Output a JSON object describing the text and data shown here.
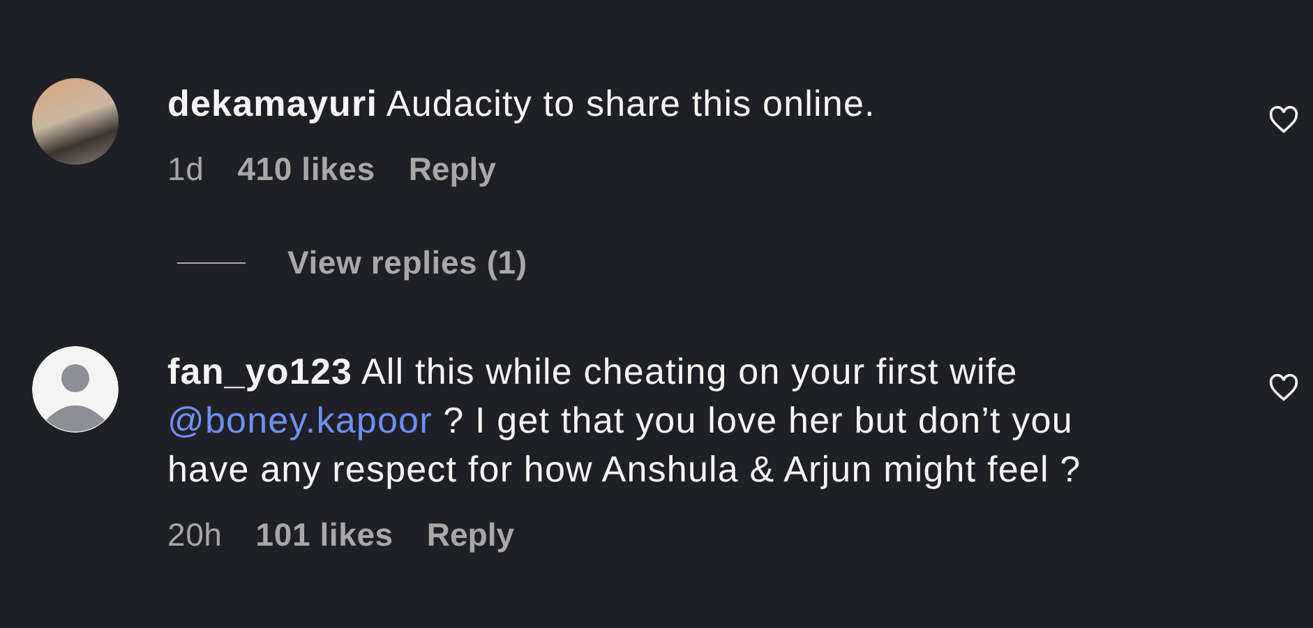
{
  "items": [
    {
      "kind": "comment",
      "username": "dekamayuri",
      "avatar": {
        "kind": "photo"
      },
      "body": [
        {
          "kind": "text",
          "text": "Audacity to share this online."
        }
      ],
      "time": "1d",
      "likes": "410 likes",
      "reply": "Reply",
      "liked": false
    },
    {
      "kind": "replies",
      "label": "View replies (1)"
    },
    {
      "kind": "comment",
      "username": "fan_yo123",
      "avatar": {
        "kind": "default"
      },
      "body": [
        {
          "kind": "text",
          "text": "All this while cheating on your first wife "
        },
        {
          "kind": "mention",
          "text": "@boney.kapoor"
        },
        {
          "kind": "text",
          "text": " ? I get that you love her but don’t you have any respect for how Anshula & Arjun might feel ?"
        }
      ],
      "time": "20h",
      "likes": "101 likes",
      "reply": "Reply",
      "liked": false
    }
  ]
}
